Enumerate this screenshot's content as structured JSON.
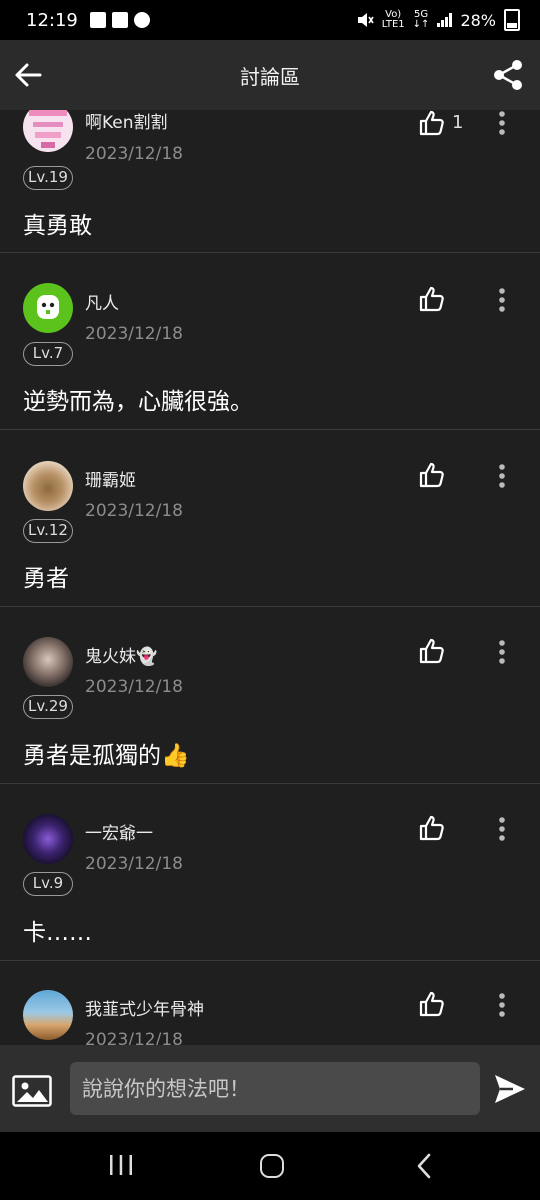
{
  "status_bar": {
    "time": "12:19",
    "net_top": "Vo)",
    "net_bottom": "LTE1",
    "g5": "5G",
    "battery": "28%"
  },
  "header": {
    "title": "討論區"
  },
  "comments": [
    {
      "username": "啊Ken割割",
      "date": "2023/12/18",
      "level": "Lv.19",
      "text": "真勇敢",
      "likes": "1"
    },
    {
      "username": "凡人",
      "date": "2023/12/18",
      "level": "Lv.7",
      "text": "逆勢而為，心臟很強。",
      "likes": ""
    },
    {
      "username": "珊霸姬",
      "date": "2023/12/18",
      "level": "Lv.12",
      "text": "勇者",
      "likes": ""
    },
    {
      "username": "鬼火妹👻",
      "date": "2023/12/18",
      "level": "Lv.29",
      "text": "勇者是孤獨的👍",
      "likes": ""
    },
    {
      "username": "一宏爺一",
      "date": "2023/12/18",
      "level": "Lv.9",
      "text": "卡……",
      "likes": ""
    },
    {
      "username": "我韮式少年骨神",
      "date": "2023/12/18",
      "level": "",
      "text": "",
      "likes": ""
    }
  ],
  "composer": {
    "placeholder": "說說你的想法吧！"
  },
  "icons": {
    "back": "arrow-left-icon",
    "share": "share-icon",
    "like": "thumbs-up-icon",
    "more": "more-vertical-icon",
    "image": "image-icon",
    "send": "send-icon"
  },
  "colors": {
    "background": "#1f1f1f",
    "header": "#2b2b2b",
    "divider": "#3a3a3a",
    "date_text": "#8c8c8c"
  }
}
